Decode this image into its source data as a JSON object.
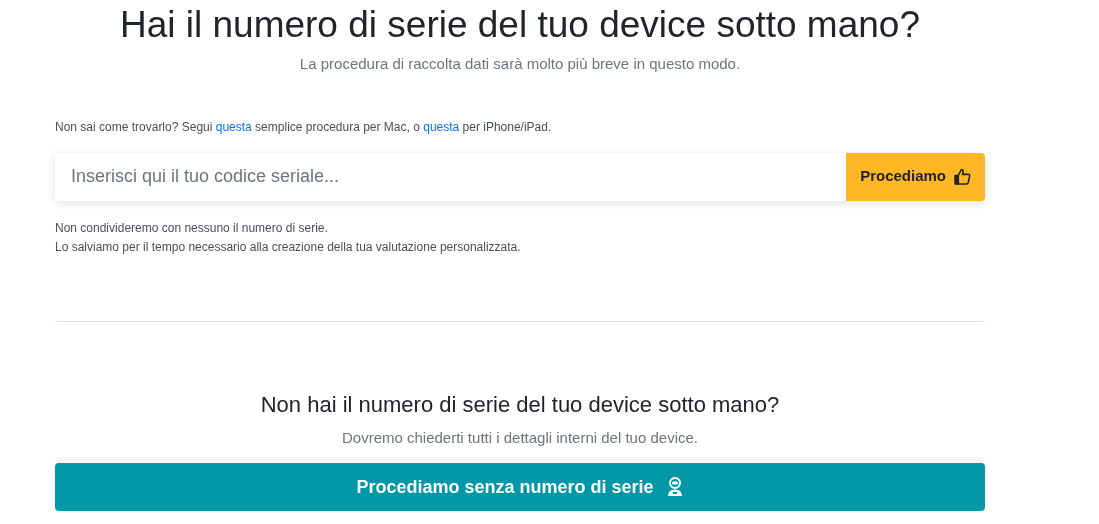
{
  "heading": {
    "title": "Hai il numero di serie del tuo device sotto mano?",
    "subtitle": "La procedura di raccolta dati sarà molto più breve in questo modo."
  },
  "hint": [
    {
      "kind": "text",
      "text": "Non sai come trovarlo? Segui "
    },
    {
      "kind": "link",
      "text": "questa"
    },
    {
      "kind": "text",
      "text": " semplice procedura per Mac, o "
    },
    {
      "kind": "link",
      "text": "questa"
    },
    {
      "kind": "text",
      "text": " per iPhone/iPad."
    }
  ],
  "serial_form": {
    "placeholder": "Inserisci qui il tuo codice seriale...",
    "button": "Procediamo"
  },
  "notes": [
    "Non condivideremo con nessuno il numero di serie.",
    "Lo salviamo per il tempo necessario alla creazione della tua valutazione personalizzata."
  ],
  "alternative": {
    "title": "Non hai il numero di serie del tuo device sotto mano?",
    "subtitle": "Dovremo chiederti tutti i dettagli interni del tuo device.",
    "button": "Procediamo senza numero di serie"
  }
}
